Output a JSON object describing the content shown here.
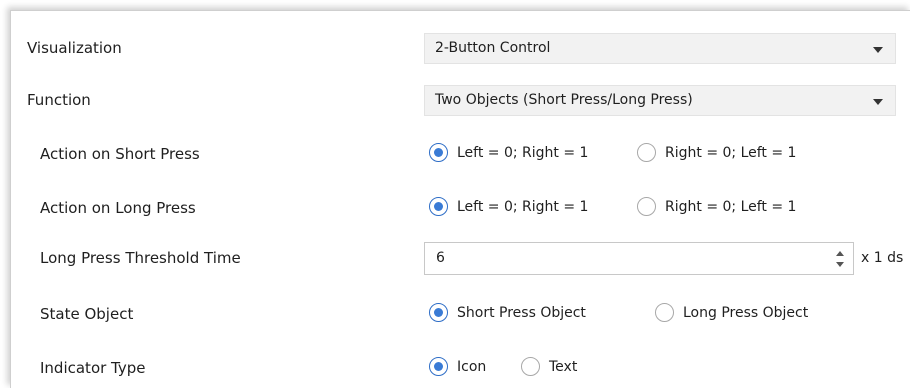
{
  "rows": {
    "visualization": {
      "label": "Visualization",
      "value": "2-Button Control"
    },
    "function": {
      "label": "Function",
      "value": "Two Objects (Short Press/Long Press)"
    },
    "short_press": {
      "label": "Action on Short Press",
      "options": [
        "Left = 0; Right = 1",
        "Right = 0; Left = 1"
      ],
      "selected": "Left = 0; Right = 1"
    },
    "long_press": {
      "label": "Action on Long Press",
      "options": [
        "Left = 0; Right = 1",
        "Right = 0; Left = 1"
      ],
      "selected": "Left = 0; Right = 1"
    },
    "threshold": {
      "label": "Long Press Threshold Time",
      "value": "6",
      "unit": "x 1 ds"
    },
    "state_object": {
      "label": "State Object",
      "options": [
        "Short Press Object",
        "Long Press Object"
      ],
      "selected": "Short Press Object"
    },
    "indicator_type": {
      "label": "Indicator Type",
      "options": [
        "Icon",
        "Text"
      ],
      "selected": "Icon"
    }
  },
  "colors": {
    "radio_selected": "#3a7bd5",
    "select_bg": "#f2f2f2"
  }
}
